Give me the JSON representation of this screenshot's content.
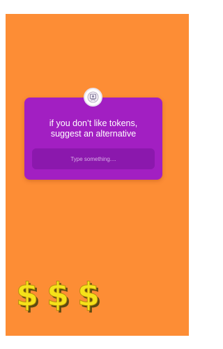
{
  "story": {
    "background_color": "#fd8d35"
  },
  "question_sticker": {
    "card_color": "#a21fc2",
    "avatar_icon": "profile-avatar-icon",
    "prompt_line_1": "if you don’t like tokens,",
    "prompt_line_2": "suggest an alternative",
    "input_placeholder": "Type something....",
    "input_value": ""
  },
  "dollar_sticker": {
    "icon": "gold-dollar-signs-icon",
    "glyphs": [
      "$",
      "$",
      "$"
    ],
    "color": "#f5e21a"
  }
}
